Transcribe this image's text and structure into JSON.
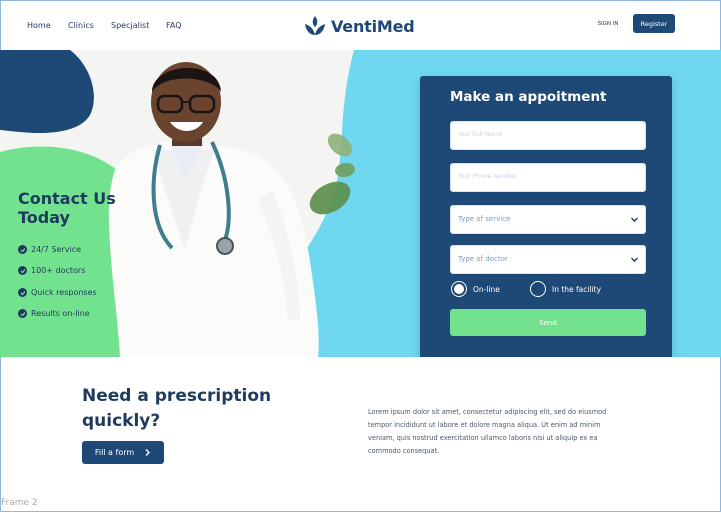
{
  "nav": {
    "links": [
      "Home",
      "Clinics",
      "Specjalist",
      "FAQ"
    ],
    "logo_text": "VentiMed",
    "sign_in": "SIGN IN",
    "register": "Register"
  },
  "hero": {
    "contact_title": "Contact Us Today",
    "features": [
      "24/7 Service",
      "100+ doctors",
      "Quick responses",
      "Results on-line"
    ]
  },
  "form": {
    "title": "Make an appoitment",
    "name_placeholder": "Your Full Name",
    "phone_placeholder": "Your Phone Number",
    "service_select": "Type of service",
    "doctor_select": "Type of doctor",
    "radio_online": "On-line",
    "radio_facility": "In the facility",
    "send": "Send"
  },
  "prescription": {
    "title": "Need a prescription quickly?",
    "button": "Fill a form",
    "body": "Lorem ipsum dolor sit amet, consectetur adipiscing elit, sed do eiusmod tempor incididunt ut labore et dolore magna aliqua. Ut enim ad minim veniam, quis nostrud exercitation ullamco laboris nisi ut aliquip ex ea commodo consequat."
  },
  "frame_label": "Frame 2",
  "colors": {
    "navy": "#1e4976",
    "green": "#73e28f",
    "cyan": "#6fd8f0",
    "text": "#1e3a5f"
  },
  "icons": [
    "logo-leaf-icon",
    "check-icon",
    "chevron-down-icon",
    "chevron-right-icon"
  ]
}
